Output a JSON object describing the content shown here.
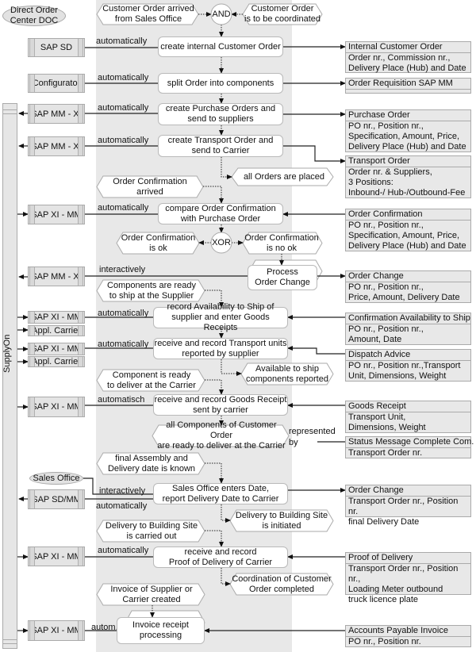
{
  "lane_label": "SupplyOn",
  "orgs": {
    "doc": "Direct Order\nCenter DOC",
    "sales_office": "Sales Office"
  },
  "operators": {
    "and": "AND",
    "xor": "XOR"
  },
  "systems": [
    "SAP SD",
    "Configurator",
    "SAP MM - XI",
    "SAP MM - XI",
    "SAP XI - MM",
    "SAP MM - XI",
    "SAP XI - MM",
    "Appl. Carrier",
    "SAP XI - MM",
    "Appl. Carrier",
    "SAP XI - MM",
    "SAP SD/MM",
    "SAP XI - MM",
    "SAP XI - MM"
  ],
  "connector_labels": {
    "automatically": "automatically",
    "interactively": "interactively",
    "automatisch": "automatisch",
    "autom": "autom.",
    "represented": "represented",
    "by": "by"
  },
  "events": {
    "e1": "Customer Order arrived\nfrom Sales Office",
    "e2": "Customer Order\nis to be coordinated",
    "e3": "all Orders are placed",
    "e4": "Order Confirmation\narrived",
    "e5": "Order Confirmation\nis ok",
    "e6": "Order Confirmation\nis no ok",
    "e7": "Components are ready\nto ship at the Supplier",
    "e8": "Available to ship\ncomponents reported",
    "e9": "Component is ready\nto deliver at the Carrier",
    "e10": "all Components of Customer Order\nare ready to deliver at the Carrier",
    "e11": "final Assembly and\nDelivery date is known",
    "e12": "Delivery to Building Site\nis initiated",
    "e13": "Delivery to Building Site\nis carried out",
    "e14": "Coordination of Customer\nOrder completed",
    "e15": "Invoice of Supplier or\nCarrier created"
  },
  "functions": {
    "f1": "create internal Customer Order",
    "f2": "split Order into components",
    "f3": "create Purchase Orders and\nsend to suppliers",
    "f4": "create Transport Order and\nsend to Carrier",
    "f5": "compare Order Confirmation\nwith Purchase Order",
    "f6": "Process\nOrder Change",
    "f7": "record Availability to Ship of\nsupplier and enter Goods Receipts",
    "f8": "receive and record Transport units\nreported by supplier",
    "f9": "receive and record Goods Receipt\nsent by carrier",
    "f10": "Sales Office enters Date,\nreport Delivery Date to Carrier",
    "f11": "receive and record\nProof of Delivery of Carrier",
    "f12": "Invoice receipt\nprocessing"
  },
  "info": [
    {
      "title": "Internal Customer Order",
      "body": "Order nr., Commission nr.,\nDelivery Place (Hub) and Date"
    },
    {
      "title": "Order Requisition SAP MM",
      "body": ""
    },
    {
      "title": "Purchase Order",
      "body": "PO nr., Position nr.,\nSpecification,  Amount, Price,\nDelivery Place (Hub) and Date"
    },
    {
      "title": "Transport Order",
      "body": "Order nr. & Suppliers,\n3 Positions:\nInbound-/  Hub-/Outbound-Fee"
    },
    {
      "title": "Order Confirmation",
      "body": "PO nr., Position nr.,\nSpecification,  Amount, Price,\nDelivery Place (Hub) and Date"
    },
    {
      "title": "Order Change",
      "body": "PO nr., Position nr.,\nPrice, Amount, Delivery Date"
    },
    {
      "title": "Confirmation Availability to Ship",
      "body": "PO nr., Position nr.,\nAmount, Date"
    },
    {
      "title": "Dispatch Advice",
      "body": "PO nr., Position nr.,Transport\nUnit, Dimensions, Weight"
    },
    {
      "title": "Goods Receipt",
      "body": "Transport Unit,\nDimensions, Weight"
    },
    {
      "title": "Status Message Complete Com.",
      "body": "Transport Order nr."
    },
    {
      "title": "Order Change",
      "body": "Transport Order nr., Position nr.\nfinal Delivery Date"
    },
    {
      "title": "Proof of Delivery",
      "body": "Transport Order nr., Position nr.,\nLoading  Meter outbound\ntruck licence plate"
    },
    {
      "title": "Accounts Payable Invoice",
      "body": "PO nr., Position nr."
    }
  ]
}
